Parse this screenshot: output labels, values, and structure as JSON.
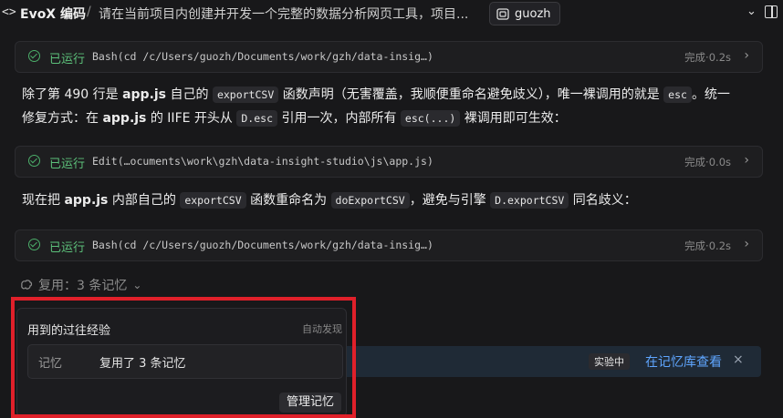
{
  "topbar": {
    "code_icon": "<>",
    "app_title": "EvoX 编码",
    "separator": "/",
    "task_title": "请在当前项目内创建并开发一个完整的数据分析网页工具，项目...",
    "user": "guozh",
    "chevron": "⌄"
  },
  "tool_runs": [
    {
      "status": "已运行",
      "command": "Bash(cd /c/Users/guozh/Documents/work/gzh/data-insig…)",
      "result": "完成·0.2s"
    },
    {
      "status": "已运行",
      "command": "Edit(…ocuments\\work\\gzh\\data-insight-studio\\js\\app.js)",
      "result": "完成·0.0s"
    },
    {
      "status": "已运行",
      "command": "Bash(cd /c/Users/guozh/Documents/work/gzh/data-insig…)",
      "result": "完成·0.2s"
    }
  ],
  "para1": {
    "a": "除了第 490 行是 ",
    "b": "app.js",
    "c": " 自己的 ",
    "d": "exportCSV",
    "e": " 函数声明（无害覆盖，我顺便重命名避免歧义），唯一裸调用的就是 ",
    "f": "esc",
    "g": "。统一",
    "h": "修复方式：在 ",
    "i": "app.js",
    "j": " 的 IIFE 开头从 ",
    "k": "D.esc",
    "l": " 引用一次，内部所有 ",
    "m": "esc(...)",
    "n": " 裸调用即可生效："
  },
  "para2": {
    "a": "现在把 ",
    "b": "app.js",
    "c": " 内部自己的 ",
    "d": "exportCSV",
    "e": " 函数重命名为 ",
    "f": "doExportCSV",
    "g": "，避免与引擎 ",
    "h": "D.exportCSV",
    "i": " 同名歧义："
  },
  "reuse": {
    "icon": "brain-icon",
    "label": "复用：3 条记忆",
    "caret": "⌄"
  },
  "popup": {
    "title": "用到的过往经验",
    "auto": "自动发现",
    "card_key": "记忆",
    "card_value": "复用了 3 条记忆",
    "manage": "管理记忆"
  },
  "banner": {
    "experimental": "实验中",
    "view_link": "在记忆库查看",
    "close": "×"
  },
  "colors": {
    "success": "#5cc07a",
    "link": "#5fa6ff",
    "highlight": "#e0202a"
  }
}
